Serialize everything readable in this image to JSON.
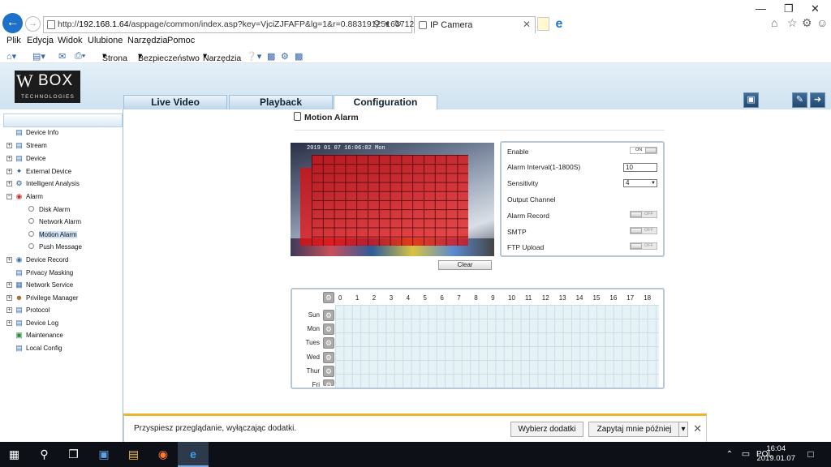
{
  "browser": {
    "url_prefix": "http://",
    "url_host": "192.168.1.64",
    "url_path": "/asppage/common/index.asp?key=VjciZJFAFP&lg=1&r=0.8831912516371261",
    "tab_title": "IP Camera",
    "menu": [
      "Plik",
      "Edycja",
      "Widok",
      "Ulubione",
      "Narzędzia",
      "Pomoc"
    ],
    "commands": {
      "page": "Strona",
      "security": "Bezpieczeństwo",
      "tools": "Narzędzia"
    }
  },
  "app": {
    "logo_top": "W",
    "logo_box": "BOX",
    "logo_sub": "TECHNOLOGIES",
    "nav_tabs": [
      "Live Video",
      "Playback",
      "Configuration"
    ],
    "active_tab": "Configuration"
  },
  "sidebar": {
    "items": [
      {
        "label": "Device Info",
        "icon": "info-icon"
      },
      {
        "label": "Stream",
        "icon": "stream-icon"
      },
      {
        "label": "Device",
        "icon": "device-icon"
      },
      {
        "label": "External Device",
        "icon": "external-device-icon"
      },
      {
        "label": "Intelligent Analysis",
        "icon": "analysis-icon"
      },
      {
        "label": "Alarm",
        "icon": "alarm-icon"
      },
      {
        "label": "Disk Alarm",
        "icon": "bullet-icon"
      },
      {
        "label": "Network Alarm",
        "icon": "bullet-icon"
      },
      {
        "label": "Motion Alarm",
        "icon": "bullet-icon"
      },
      {
        "label": "Push Message",
        "icon": "bullet-icon"
      },
      {
        "label": "Device Record",
        "icon": "record-icon"
      },
      {
        "label": "Privacy Masking",
        "icon": "privacy-icon"
      },
      {
        "label": "Network Service",
        "icon": "network-icon"
      },
      {
        "label": "Privilege Manager",
        "icon": "privilege-icon"
      },
      {
        "label": "Protocol",
        "icon": "protocol-icon"
      },
      {
        "label": "Device Log",
        "icon": "log-icon"
      },
      {
        "label": "Maintenance",
        "icon": "maintenance-icon"
      },
      {
        "label": "Local Config",
        "icon": "local-config-icon"
      }
    ]
  },
  "page": {
    "title": "Motion Alarm",
    "video_timestamp": "2019 01 07  16:06:02 Mon",
    "clear_label": "Clear",
    "enable_label": "Enable",
    "enable_state": "ON",
    "interval_label": "Alarm Interval(1-1800S)",
    "interval_value": "10",
    "sensitivity_label": "Sensitivity",
    "sensitivity_value": "4",
    "output_label": "Output Channel",
    "alarm_record_label": "Alarm Record",
    "alarm_record_state": "OFF",
    "smtp_label": "SMTP",
    "smtp_state": "OFF",
    "ftp_label": "FTP Upload",
    "ftp_state": "OFF"
  },
  "schedule": {
    "hours": [
      "0",
      "1",
      "2",
      "3",
      "4",
      "5",
      "6",
      "7",
      "8",
      "9",
      "10",
      "11",
      "12",
      "13",
      "14",
      "15",
      "16",
      "17",
      "18"
    ],
    "days": [
      "Sun",
      "Mon",
      "Tues",
      "Wed",
      "Thur",
      "Fri"
    ]
  },
  "notification": {
    "message": "Przyspiesz przeglądanie, wyłączając dodatki.",
    "choose_label": "Wybierz dodatki",
    "later_label": "Zapytaj mnie później"
  },
  "taskbar": {
    "lang": "POL",
    "time": "16:04",
    "date": "2019.01.07"
  }
}
